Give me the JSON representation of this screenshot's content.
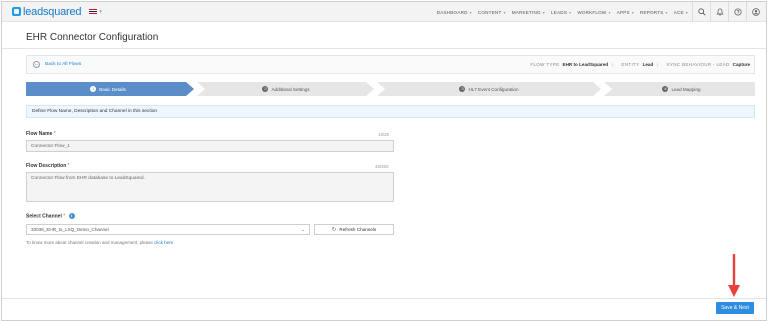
{
  "app": {
    "logo_text": "leadsquared"
  },
  "nav": {
    "items": [
      {
        "label": "DASHBOARD"
      },
      {
        "label": "CONTENT"
      },
      {
        "label": "MARKETING"
      },
      {
        "label": "LEADS"
      },
      {
        "label": "WORKFLOW"
      },
      {
        "label": "APPS"
      },
      {
        "label": "REPORTS"
      },
      {
        "label": "ACE"
      }
    ],
    "tools": [
      "search-icon",
      "bell-icon",
      "help-icon",
      "user-icon"
    ]
  },
  "page": {
    "title": "EHR Connector Configuration"
  },
  "info_bar": {
    "back_label": "Back to All Flows",
    "flow_type_key": "FLOW TYPE",
    "flow_type_value": "EHR to LeadSquared",
    "entity_key": "ENTITY",
    "entity_value": "Lead",
    "sync_key": "SYNC BEHAVIOUR - LEAD",
    "sync_value": "Capture"
  },
  "steps": [
    {
      "num": "1",
      "label": "Basic Details",
      "active": true
    },
    {
      "num": "2",
      "label": "Additional Settings",
      "active": false
    },
    {
      "num": "3",
      "label": "HL7 Event Configuration",
      "active": false
    },
    {
      "num": "4",
      "label": "Lead Mapping",
      "active": false
    }
  ],
  "instruction": "Define Flow Name, Description and Channel in this section",
  "form": {
    "flow_name_label": "Flow Name",
    "flow_name_counter": "16/25",
    "flow_name_value": "Connector Flow_1",
    "flow_desc_label": "Flow Description",
    "flow_desc_counter": "48/250",
    "flow_desc_value": "Connector Flow from EHR database to LeadSquared.",
    "channel_label": "Select Channel",
    "channel_value": "33036_EHR_to_LSQ_Demo_Channel",
    "refresh_label": "Refresh Channels",
    "help_prefix": "To know more about channel creation and management, please",
    "help_link": "click here",
    "required_mark": "*"
  },
  "footer": {
    "save_label": "Save & Next"
  },
  "colors": {
    "accent": "#2f8ddf",
    "step_active": "#5b8ec9",
    "step_inactive": "#e6e6e6",
    "arrow": "#e8403a"
  }
}
